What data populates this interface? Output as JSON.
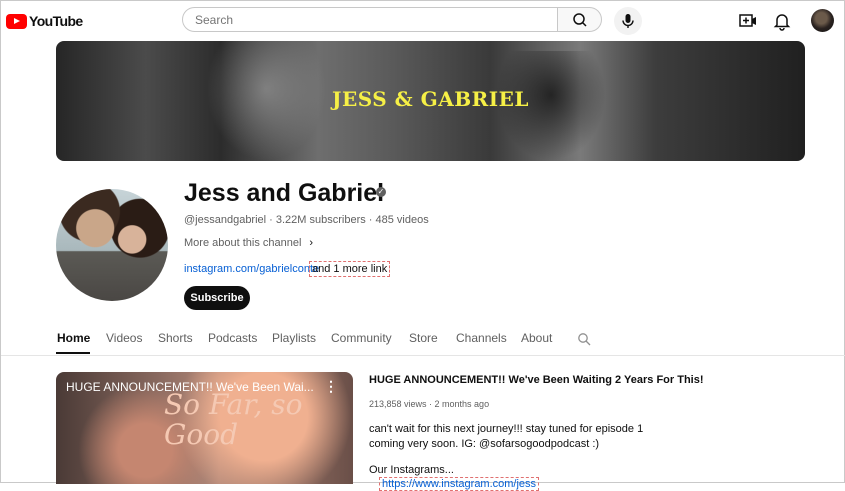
{
  "header": {
    "logo_text": "YouTube",
    "search_placeholder": "Search"
  },
  "banner": {
    "title": "JESS & GABRIEL"
  },
  "channel": {
    "name": "Jess and Gabriel",
    "handle_meta": "@jessandgabriel · 3.22M subscribers · 485 videos",
    "about_label": "More about this channel",
    "link_text": "instagram.com/gabrielconte",
    "more_links": "and 1 more link",
    "subscribe_label": "Subscribe"
  },
  "tabs": [
    "Home",
    "Videos",
    "Shorts",
    "Podcasts",
    "Playlists",
    "Community",
    "Store",
    "Channels",
    "About"
  ],
  "featured_video": {
    "thumb_title": "HUGE ANNOUNCEMENT!! We've Been Wai...",
    "thumb_text": "So Far, so Good",
    "title": "HUGE ANNOUNCEMENT!! We've Been Waiting 2 Years For This!",
    "meta": "213,858 views · 2 months ago",
    "description": "can't wait for this next journey!!! stay tuned for episode 1 coming very soon. IG: @sofarsogoodpodcast :)",
    "instagrams_label": "Our Instagrams...",
    "instagram_link": "https://www.instagram.com/jess"
  }
}
